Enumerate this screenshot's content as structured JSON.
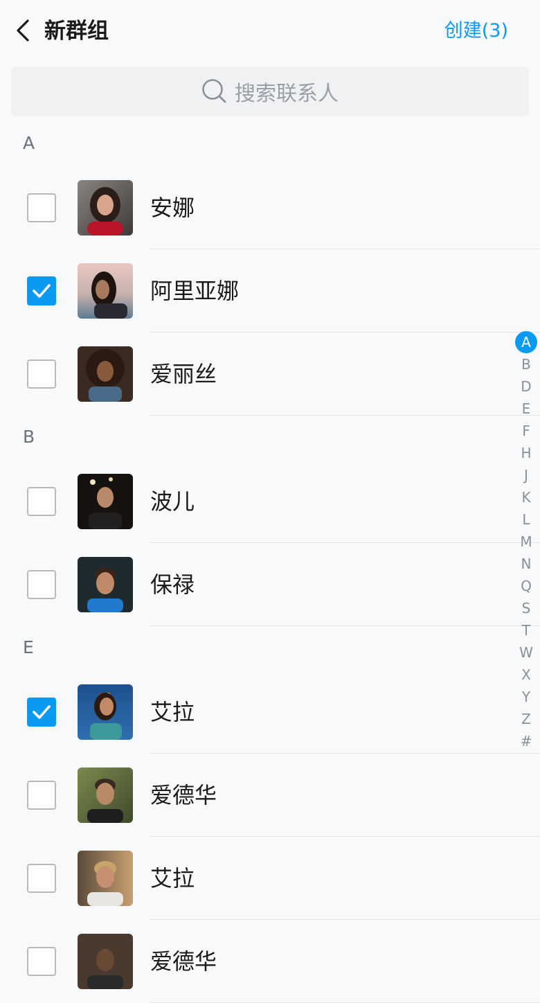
{
  "header": {
    "title": "新群组",
    "create_label": "创建(3)"
  },
  "search": {
    "placeholder": "搜索联系人"
  },
  "sections": [
    {
      "letter": "A",
      "contacts": [
        {
          "name": "安娜",
          "checked": false
        },
        {
          "name": "阿里亚娜",
          "checked": true
        },
        {
          "name": "爱丽丝",
          "checked": false
        }
      ]
    },
    {
      "letter": "B",
      "contacts": [
        {
          "name": "波儿",
          "checked": false
        },
        {
          "name": "保禄",
          "checked": false
        }
      ]
    },
    {
      "letter": "E",
      "contacts": [
        {
          "name": "艾拉",
          "checked": true
        },
        {
          "name": "爱德华",
          "checked": false
        },
        {
          "name": "艾拉",
          "checked": false
        },
        {
          "name": "爱德华",
          "checked": false
        }
      ]
    }
  ],
  "index_letters": [
    "A",
    "B",
    "D",
    "E",
    "F",
    "H",
    "J",
    "K",
    "L",
    "M",
    "N",
    "Q",
    "S",
    "T",
    "W",
    "X",
    "Y",
    "Z",
    "#"
  ],
  "index_active": "A",
  "colors": {
    "accent": "#0a9af2",
    "background": "#f8f9fa",
    "search_bg": "#f0f1f3"
  }
}
